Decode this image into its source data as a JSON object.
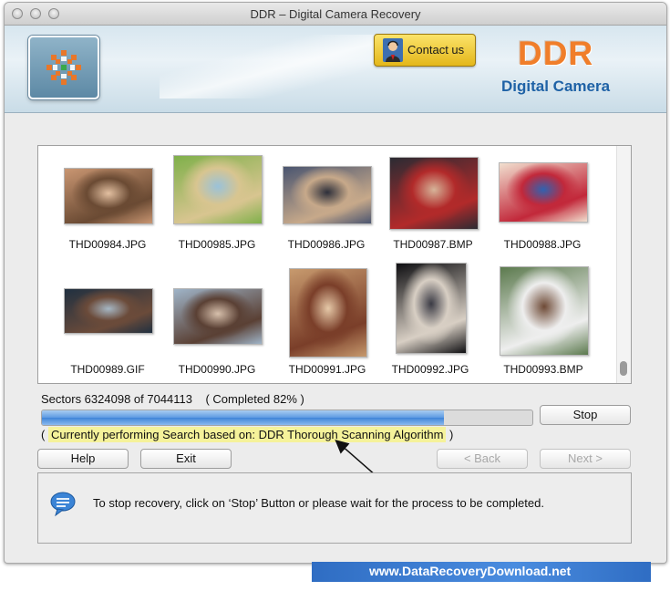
{
  "window": {
    "title": "DDR – Digital Camera Recovery"
  },
  "header": {
    "contact_label": "Contact us",
    "brand_ddr": "DDR",
    "brand_sub": "Digital Camera",
    "brand_color": "#f07e2a",
    "sub_color": "#1f62a6"
  },
  "gallery": {
    "items": [
      {
        "name": "THD00984.JPG",
        "palette": [
          "#c99672",
          "#6a4a33",
          "#e3c0a1"
        ]
      },
      {
        "name": "THD00985.JPG",
        "palette": [
          "#7fb04a",
          "#d8c590",
          "#9ac2d9"
        ]
      },
      {
        "name": "THD00986.JPG",
        "palette": [
          "#4a5570",
          "#c7a98a",
          "#2d2f3a"
        ]
      },
      {
        "name": "THD00987.BMP",
        "palette": [
          "#2b2b33",
          "#b22a2a",
          "#d6b499"
        ]
      },
      {
        "name": "THD00988.JPG",
        "palette": [
          "#f1dfcf",
          "#c2283a",
          "#2f63b1"
        ]
      },
      {
        "name": "THD00989.GIF",
        "palette": [
          "#203040",
          "#6b4b3a",
          "#a6b7c4"
        ]
      },
      {
        "name": "THD00990.JPG",
        "palette": [
          "#9fb4c8",
          "#5a4034",
          "#d7c0ac"
        ]
      },
      {
        "name": "THD00991.JPG",
        "palette": [
          "#c79a6e",
          "#7a3e29",
          "#e6c9a8"
        ]
      },
      {
        "name": "THD00992.JPG",
        "palette": [
          "#0f0f12",
          "#d8cfc4",
          "#3a3a44"
        ]
      },
      {
        "name": "THD00993.BMP",
        "palette": [
          "#5c7a4e",
          "#eeeeee",
          "#6e4a36"
        ]
      }
    ]
  },
  "progress": {
    "sectors_text": "Sectors 6324098 of 7044113",
    "completed_text": "( Completed 82% )",
    "percent": 82,
    "stop_label": "Stop"
  },
  "status": {
    "open_paren": "(",
    "text": "Currently performing Search based on: DDR Thorough Scanning Algorithm",
    "close_paren": ")"
  },
  "buttons": {
    "help": "Help",
    "exit": "Exit",
    "back": "< Back",
    "next": "Next >"
  },
  "info": {
    "message": "To stop recovery, click on ‘Stop’ Button or please wait for the process to be completed."
  },
  "footer": {
    "url": "www.DataRecoveryDownload.net"
  }
}
